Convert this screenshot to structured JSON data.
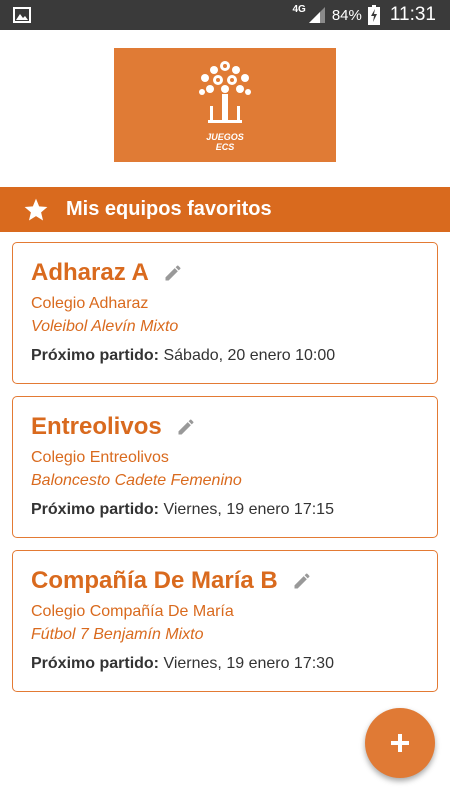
{
  "status_bar": {
    "network": "4G",
    "battery": "84%",
    "time": "11:31"
  },
  "logo": {
    "line1": "JUEGOS",
    "line2": "ECS"
  },
  "section": {
    "title": "Mis equipos favoritos"
  },
  "teams": [
    {
      "name": "Adharaz A",
      "school": "Colegio Adharaz",
      "sport": "Voleibol Alevín Mixto",
      "next_label": "Próximo partido:",
      "next_value": "Sábado, 20 enero 10:00"
    },
    {
      "name": "Entreolivos",
      "school": "Colegio Entreolivos",
      "sport": "Baloncesto Cadete Femenino",
      "next_label": "Próximo partido:",
      "next_value": "Viernes, 19 enero 17:15"
    },
    {
      "name": "Compañía De María B",
      "school": "Colegio Compañía De María",
      "sport": "Fútbol 7 Benjamín Mixto",
      "next_label": "Próximo partido:",
      "next_value": "Viernes, 19 enero 17:30"
    }
  ],
  "fab": {
    "icon": "plus-icon"
  },
  "colors": {
    "accent": "#d96a1e",
    "logo_bg": "#e07b35",
    "status_bar": "#3a3a3a"
  }
}
